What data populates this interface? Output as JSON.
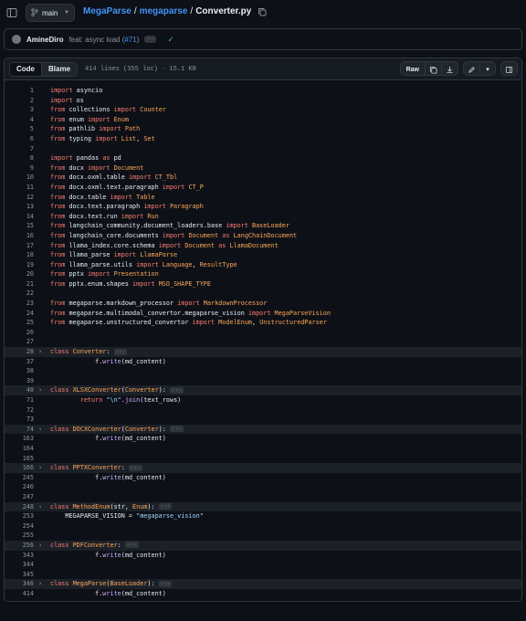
{
  "topbar": {
    "branch": "main",
    "repo": "MegaParse",
    "folder": "megaparse",
    "file": "Converter.py",
    "sep": "/"
  },
  "commit": {
    "author": "AmineDiro",
    "message": "feat: async load (",
    "pr": "#71",
    "close": ")"
  },
  "file_header": {
    "tab_code": "Code",
    "tab_blame": "Blame",
    "meta": "414 lines (355 loc) · 15.1 KB",
    "raw": "Raw"
  },
  "code": [
    {
      "n": "1",
      "t": "import asyncio"
    },
    {
      "n": "2",
      "t": "import os"
    },
    {
      "n": "3",
      "t": "from collections import Counter"
    },
    {
      "n": "4",
      "t": "from enum import Enum"
    },
    {
      "n": "5",
      "t": "from pathlib import Path"
    },
    {
      "n": "6",
      "t": "from typing import List, Set"
    },
    {
      "n": "7",
      "t": ""
    },
    {
      "n": "8",
      "t": "import pandas as pd"
    },
    {
      "n": "9",
      "t": "from docx import Document"
    },
    {
      "n": "10",
      "t": "from docx.oxml.table import CT_Tbl"
    },
    {
      "n": "11",
      "t": "from docx.oxml.text.paragraph import CT_P"
    },
    {
      "n": "12",
      "t": "from docx.table import Table"
    },
    {
      "n": "13",
      "t": "from docx.text.paragraph import Paragraph"
    },
    {
      "n": "14",
      "t": "from docx.text.run import Run"
    },
    {
      "n": "15",
      "t": "from langchain_community.document_loaders.base import BaseLoader"
    },
    {
      "n": "16",
      "t": "from langchain_core.documents import Document as LangChainDocument"
    },
    {
      "n": "17",
      "t": "from llama_index.core.schema import Document as LlamaDocument"
    },
    {
      "n": "18",
      "t": "from llama_parse import LlamaParse"
    },
    {
      "n": "19",
      "t": "from llama_parse.utils import Language, ResultType"
    },
    {
      "n": "20",
      "t": "from pptx import Presentation"
    },
    {
      "n": "21",
      "t": "from pptx.enum.shapes import MSO_SHAPE_TYPE"
    },
    {
      "n": "22",
      "t": ""
    },
    {
      "n": "23",
      "t": "from megaparse.markdown_processor import MarkdownProcessor"
    },
    {
      "n": "24",
      "t": "from megaparse.multimodal_convertor.megaparse_vision import MegaParseVision"
    },
    {
      "n": "25",
      "t": "from megaparse.unstructured_convertor import ModelEnum, UnstructuredParser"
    },
    {
      "n": "26",
      "t": ""
    },
    {
      "n": "27",
      "t": ""
    },
    {
      "n": "28",
      "t": "class Converter:",
      "fold": true
    },
    {
      "n": "37",
      "t": "            f.write(md_content)"
    },
    {
      "n": "38",
      "t": ""
    },
    {
      "n": "39",
      "t": ""
    },
    {
      "n": "40",
      "t": "class XLSXConverter(Converter):",
      "fold": true
    },
    {
      "n": "71",
      "t": "        return \"\\n\".join(text_rows)"
    },
    {
      "n": "72",
      "t": ""
    },
    {
      "n": "73",
      "t": ""
    },
    {
      "n": "74",
      "t": "class DOCXConverter(Converter):",
      "fold": true
    },
    {
      "n": "163",
      "t": "            f.write(md_content)"
    },
    {
      "n": "164",
      "t": ""
    },
    {
      "n": "165",
      "t": ""
    },
    {
      "n": "166",
      "t": "class PPTXConverter:",
      "fold": true
    },
    {
      "n": "245",
      "t": "            f.write(md_content)"
    },
    {
      "n": "246",
      "t": ""
    },
    {
      "n": "247",
      "t": ""
    },
    {
      "n": "248",
      "t": "class MethodEnum(str, Enum):",
      "fold": true
    },
    {
      "n": "253",
      "t": "    MEGAPARSE_VISION = \"megaparse_vision\""
    },
    {
      "n": "254",
      "t": ""
    },
    {
      "n": "255",
      "t": ""
    },
    {
      "n": "256",
      "t": "class PDFConverter:",
      "fold": true
    },
    {
      "n": "343",
      "t": "            f.write(md_content)"
    },
    {
      "n": "344",
      "t": ""
    },
    {
      "n": "345",
      "t": ""
    },
    {
      "n": "346",
      "t": "class MegaParse(BaseLoader):",
      "fold": true
    },
    {
      "n": "414",
      "t": "            f.write(md_content)"
    }
  ],
  "colors": {
    "background": "#0d1117",
    "link": "#4493f8",
    "keyword": "#ff7b72",
    "class_name": "#ffa657",
    "function": "#d2a8ff",
    "string": "#a5d6ff"
  }
}
